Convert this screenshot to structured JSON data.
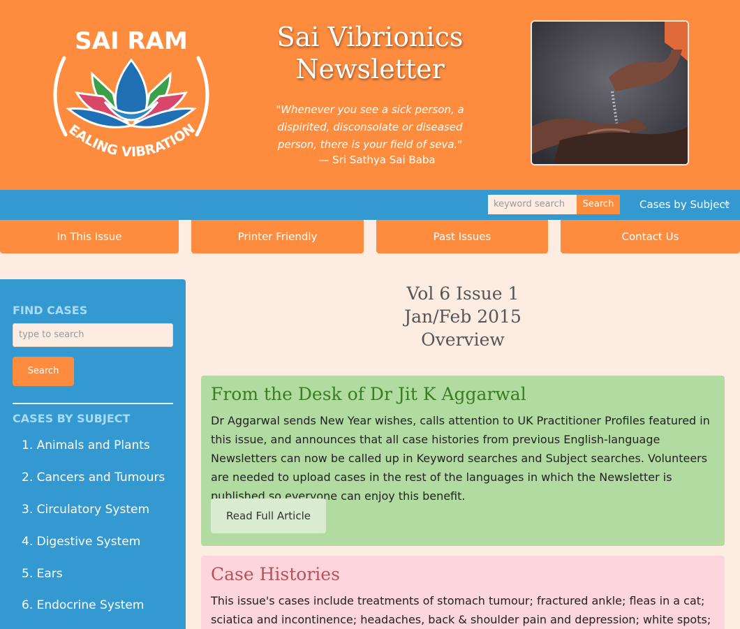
{
  "header": {
    "logo_top_text": "SAI RAM",
    "logo_bottom_text": "HEALING VIBRATIONS",
    "title_line1": "Sai Vibrionics",
    "title_line2": "Newsletter",
    "quote": "\"Whenever you see a sick person, a dispirited, disconsolate or diseased person, there is your field of seva.\"",
    "quote_author": "— Sri Sathya Sai Baba",
    "image_subject": "hands-receiving-vibhuti"
  },
  "navbar": {
    "search_placeholder": "keyword search",
    "search_button": "Search",
    "cases_by_subject": "Cases by Subject"
  },
  "tabs": [
    {
      "label": "In This Issue"
    },
    {
      "label": "Printer Friendly"
    },
    {
      "label": "Past Issues"
    },
    {
      "label": "Contact Us"
    }
  ],
  "sidebar": {
    "find_cases_heading": "FIND CASES",
    "search_placeholder": "type to search",
    "search_button": "Search",
    "subjects_heading": "CASES BY SUBJECT",
    "items": [
      {
        "label": "1. Animals and Plants"
      },
      {
        "label": "2. Cancers and Tumours"
      },
      {
        "label": "3. Circulatory System"
      },
      {
        "label": "4. Digestive System"
      },
      {
        "label": "5. Ears"
      },
      {
        "label": "6. Endocrine System"
      }
    ]
  },
  "main": {
    "issue_line1": "Vol 6 Issue 1",
    "issue_line2": "Jan/Feb 2015",
    "issue_line3": "Overview",
    "articles": [
      {
        "title": "From the Desk of Dr Jit K Aggarwal",
        "body": "Dr Aggarwal sends New Year wishes, calls attention to UK Practitioner Profiles featured in this issue, and announces that all case histories from previous English-language Newsletters can now be called up in Keyword searches and Subject searches. Volunteers are needed to upload cases in the rest of the languages in which the Newsletter is published so everyone can enjoy this benefit.",
        "button": "Read Full Article"
      },
      {
        "title": "Case Histories",
        "body": "This issue's cases include treatments of stomach tumour; fractured ankle; fleas in a cat; sciatica and incontinence; headaches, back & shoulder pain and depression; white spots;"
      }
    ]
  },
  "colors": {
    "orange": "#fd8c3f",
    "blue": "#3499d1",
    "cream": "#fdece2",
    "green_card": "#b2dba1",
    "pink_card": "#fdd5dc"
  }
}
